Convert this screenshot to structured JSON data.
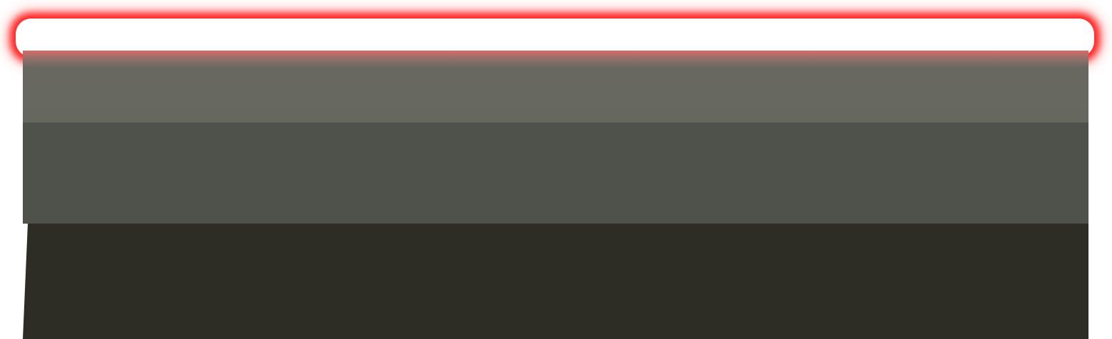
{
  "colors": {
    "highlight": "#ff1a1a",
    "header": "#ffffff",
    "band_light": "#66675f",
    "band_mid": "#4f514b",
    "band_dark": "#2d2d25"
  }
}
